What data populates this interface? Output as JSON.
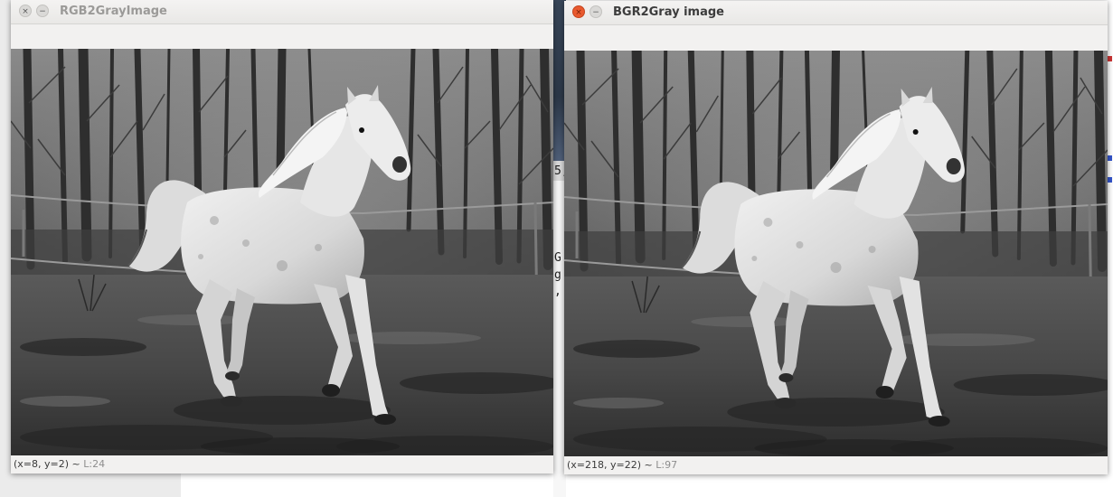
{
  "windows": [
    {
      "title": "RGB2GrayImage",
      "status": {
        "coords": "(x=8, y=2) ~ ",
        "luminance": "L:24"
      }
    },
    {
      "title": "BGR2Gray image",
      "status": {
        "coords": "(x=218, y=22) ~ ",
        "luminance": "L:97"
      }
    }
  ],
  "titlebar_buttons": {
    "close": "×",
    "minimize": "−"
  },
  "background_fragments": [
    {
      "id": "frag-1",
      "text": "5,"
    },
    {
      "id": "frag-2",
      "text": "G"
    },
    {
      "id": "frag-3",
      "text": "g"
    },
    {
      "id": "frag-4",
      "text": ","
    }
  ],
  "image_content": "grayscale photo: white horse galloping in a muddy paddock, bare trees and fence in background",
  "colors": {
    "close_active": "#e95a2f",
    "title_active": "#3c3c3c",
    "title_inactive": "#9b9a98",
    "window_bg": "#f2f1f0"
  }
}
